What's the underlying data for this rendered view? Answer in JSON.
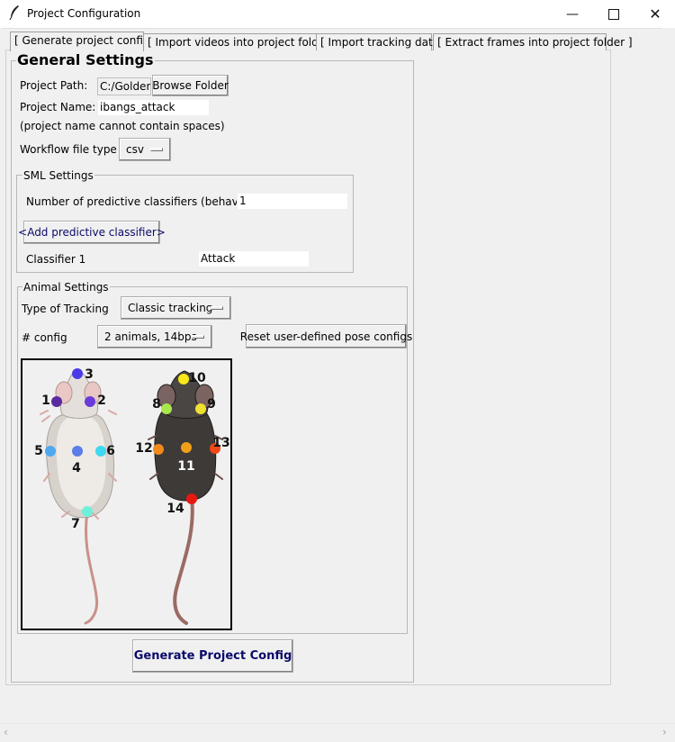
{
  "window": {
    "title": "Project Configuration"
  },
  "tabs": [
    {
      "label": "[ Generate project config ]",
      "active": true
    },
    {
      "label": "[ Import videos into project folder ]",
      "active": false
    },
    {
      "label": "[ Import tracking data ]",
      "active": false
    },
    {
      "label": "[ Extract frames into project folder ]",
      "active": false
    }
  ],
  "general": {
    "title": "General Settings",
    "project_path_label": "Project Path:",
    "project_path_value": "C:/Golden",
    "browse_label": "Browse Folder",
    "project_name_label": "Project Name:",
    "project_name_value": "ibangs_attack",
    "project_name_note": "(project name cannot contain spaces)",
    "workflow_label": "Workflow file type",
    "workflow_value": "csv"
  },
  "sml": {
    "title": "SML Settings",
    "num_classifiers_label": "Number of predictive classifiers (behaviors):",
    "num_classifiers_value": "1",
    "add_button_label": "<Add predictive classifier>",
    "classifier_label": "Classifier 1",
    "classifier_value": "Attack"
  },
  "animal": {
    "title": "Animal Settings",
    "tracking_label": "Type of Tracking",
    "tracking_value": "Classic tracking",
    "config_label": "# config",
    "config_value": "2 animals, 14bps",
    "reset_label": "Reset user-defined pose configs"
  },
  "bodyparts": {
    "mouse1": [
      {
        "id": "1",
        "color": "#5b2a9e"
      },
      {
        "id": "2",
        "color": "#6a3bd8"
      },
      {
        "id": "3",
        "color": "#4a3be8"
      },
      {
        "id": "4",
        "color": "#5b7de8"
      },
      {
        "id": "5",
        "color": "#4ea8f0"
      },
      {
        "id": "6",
        "color": "#3fd8f0"
      },
      {
        "id": "7",
        "color": "#6ff0d8"
      }
    ],
    "mouse2": [
      {
        "id": "8",
        "color": "#a8e84a"
      },
      {
        "id": "9",
        "color": "#f0e030"
      },
      {
        "id": "10",
        "color": "#f8e818"
      },
      {
        "id": "11",
        "color": "#f0a018"
      },
      {
        "id": "12",
        "color": "#f08a18"
      },
      {
        "id": "13",
        "color": "#f04818"
      },
      {
        "id": "14",
        "color": "#e81810"
      }
    ]
  },
  "generate_button_label": "Generate Project Config"
}
